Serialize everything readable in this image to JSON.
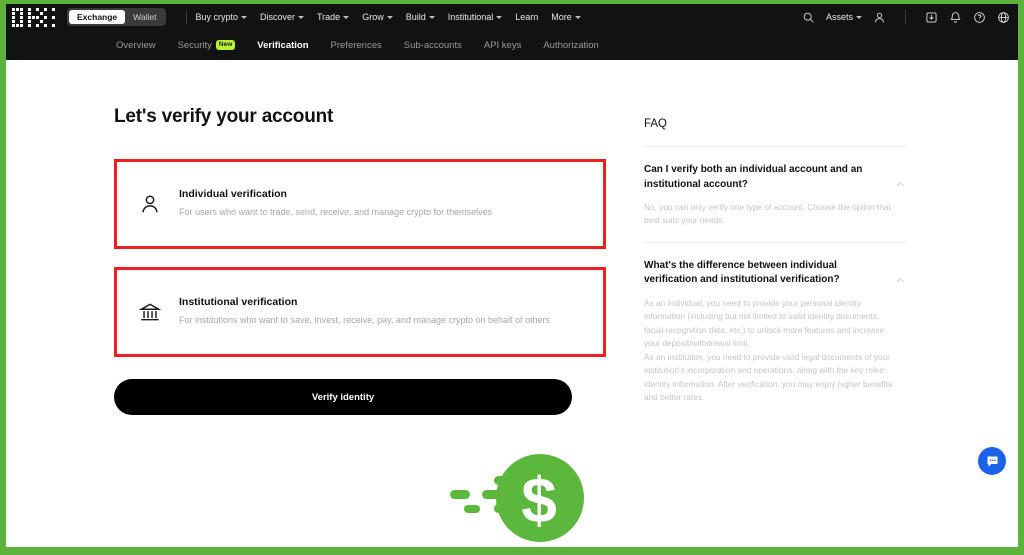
{
  "theme": {
    "frame_green": "#5cb33c",
    "nav_bg": "#121212",
    "accent_red": "#f01f1f",
    "badge_green": "#b9f531",
    "chat_blue": "#1b62e8",
    "coin_green": "#5cb83c"
  },
  "topbar": {
    "logo": "okx-logo",
    "segmented": [
      {
        "label": "Exchange",
        "active": true
      },
      {
        "label": "Wallet",
        "active": false
      }
    ],
    "nav": [
      {
        "label": "Buy crypto",
        "has_caret": true
      },
      {
        "label": "Discover",
        "has_caret": true
      },
      {
        "label": "Trade",
        "has_caret": true
      },
      {
        "label": "Grow",
        "has_caret": true
      },
      {
        "label": "Build",
        "has_caret": true
      },
      {
        "label": "Institutional",
        "has_caret": true
      },
      {
        "label": "Learn",
        "has_caret": false
      },
      {
        "label": "More",
        "has_caret": true
      }
    ],
    "right": {
      "search_icon": "search-icon",
      "assets_label": "Assets",
      "profile_icon": "person-icon",
      "download_icon": "download-icon",
      "notification_icon": "bell-icon",
      "help_icon": "help-circle-icon",
      "language_icon": "globe-icon"
    }
  },
  "subnav": {
    "items": [
      {
        "label": "Overview",
        "active": false,
        "badge": ""
      },
      {
        "label": "Security",
        "active": false,
        "badge": "New"
      },
      {
        "label": "Verification",
        "active": true,
        "badge": ""
      },
      {
        "label": "Preferences",
        "active": false,
        "badge": ""
      },
      {
        "label": "Sub-accounts",
        "active": false,
        "badge": ""
      },
      {
        "label": "API keys",
        "active": false,
        "badge": ""
      },
      {
        "label": "Authorization",
        "active": false,
        "badge": ""
      }
    ]
  },
  "main": {
    "title": "Let's verify your account",
    "options": [
      {
        "icon": "person-icon",
        "title": "Individual verification",
        "desc": "For users who want to trade, send, receive, and manage crypto for themselves",
        "highlighted": true
      },
      {
        "icon": "bank-icon",
        "title": "Institutional verification",
        "desc": "For institutions who want to save, invest, receive, pay, and manage crypto on behalf of others",
        "highlighted": true
      }
    ],
    "cta_label": "Verify identity"
  },
  "faq": {
    "title": "FAQ",
    "items": [
      {
        "question": "Can I verify both an individual account and an institutional account?",
        "answer": "No, you can only verify one type of account. Choose the option that best suits your needs.",
        "expanded": true
      },
      {
        "question": "What's the difference between individual verification and institutional verification?",
        "answer": "As an individual, you need to provide your personal identity information (including but not limited to valid identity documents, facial recognition data, etc.) to unlock more features and increase your deposit/withdrawal limit.\nAs an institution, you need to provide valid legal documents of your institution's incorporation and operations, along with the key roles' identity information. After verification, you may enjoy higher benefits and better rates.",
        "expanded": true
      }
    ]
  },
  "graphics": {
    "coin_icon": "dollar-coin-speed-icon",
    "chat_icon": "chat-bubble-icon"
  }
}
